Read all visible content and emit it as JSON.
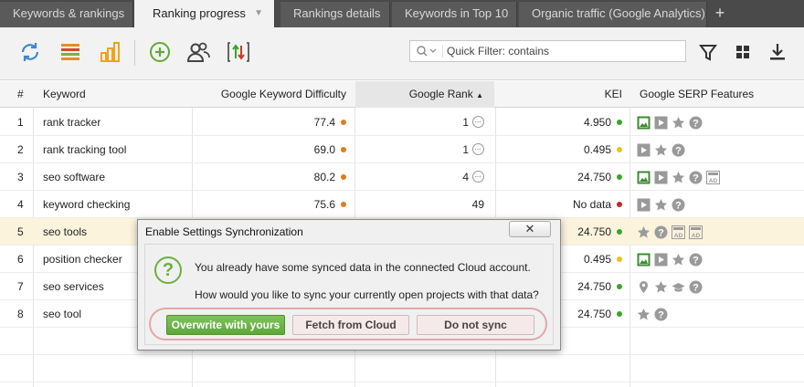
{
  "tabs": [
    {
      "label": "Keywords & rankings",
      "active": false
    },
    {
      "label": "Ranking progress",
      "active": true
    },
    {
      "label": "Rankings details",
      "active": false
    },
    {
      "label": "Keywords in Top 10",
      "active": false
    },
    {
      "label": "Organic traffic (Google Analytics)",
      "active": false
    }
  ],
  "tab_add_label": "+",
  "toolbar": {
    "icons": [
      "refresh-icon",
      "list-icon",
      "bar-chart-icon",
      "add-icon",
      "users-icon",
      "sort-arrows-icon"
    ],
    "filter_placeholder": "Quick Filter: contains",
    "right_icons": [
      "filter-icon",
      "grid-icon",
      "download-icon"
    ]
  },
  "table": {
    "headers": {
      "num": "#",
      "keyword": "Keyword",
      "difficulty": "Google Keyword Difficulty",
      "rank": "Google Rank",
      "kei": "KEI",
      "serp": "Google SERP Features"
    },
    "rows": [
      {
        "num": "1",
        "keyword": "rank tracker",
        "difficulty": "77.4",
        "rank": "1",
        "kei": "4.950",
        "kei_color": "#3aa529",
        "serp": [
          "image",
          "video",
          "star",
          "question"
        ]
      },
      {
        "num": "2",
        "keyword": "rank tracking tool",
        "difficulty": "69.0",
        "rank": "1",
        "kei": "0.495",
        "kei_color": "#e6c21a",
        "serp": [
          "video",
          "star",
          "question"
        ]
      },
      {
        "num": "3",
        "keyword": "seo software",
        "difficulty": "80.2",
        "rank": "4",
        "kei": "24.750",
        "kei_color": "#3aa529",
        "serp": [
          "image",
          "video",
          "star",
          "question",
          "ad"
        ]
      },
      {
        "num": "4",
        "keyword": "keyword checking",
        "difficulty": "75.6",
        "rank": "49",
        "kei": "No data",
        "kei_color": "#c0262c",
        "serp": [
          "video",
          "star",
          "question"
        ]
      },
      {
        "num": "5",
        "keyword": "seo tools",
        "difficulty": "",
        "rank": "",
        "kei": "24.750",
        "kei_color": "#3aa529",
        "serp": [
          "star",
          "question",
          "ad",
          "ad"
        ]
      },
      {
        "num": "6",
        "keyword": "position checker",
        "difficulty": "",
        "rank": "",
        "kei": "0.495",
        "kei_color": "#e6c21a",
        "serp": [
          "image",
          "video",
          "star",
          "question"
        ]
      },
      {
        "num": "7",
        "keyword": "seo services",
        "difficulty": "",
        "rank": "",
        "kei": "24.750",
        "kei_color": "#3aa529",
        "serp": [
          "pin",
          "star",
          "cap",
          "question"
        ]
      },
      {
        "num": "8",
        "keyword": "seo tool",
        "difficulty": "",
        "rank": "",
        "kei": "24.750",
        "kei_color": "#3aa529",
        "serp": [
          "star",
          "question"
        ]
      }
    ],
    "difficulty_dot_color": "#e07a1f"
  },
  "dialog": {
    "title": "Enable Settings Synchronization",
    "close_label": "✕",
    "message1": "You already have some synced data in the connected Cloud account.",
    "message2": "How would you like to sync your currently open projects with that data?",
    "buttons": {
      "overwrite": "Overwrite with yours",
      "fetch": "Fetch from Cloud",
      "nosync": "Do not sync"
    }
  }
}
